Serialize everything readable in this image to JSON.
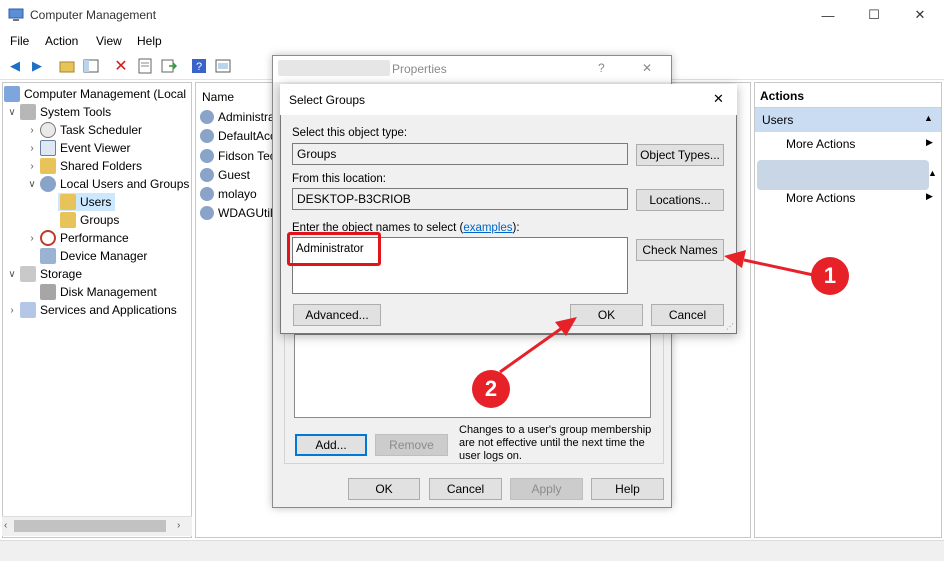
{
  "window": {
    "title": "Computer Management",
    "minimize": "—",
    "maximize": "☐",
    "close": "✕"
  },
  "menu": [
    "File",
    "Action",
    "View",
    "Help"
  ],
  "tree": {
    "root": "Computer Management (Local",
    "system_tools": "System Tools",
    "task_scheduler": "Task Scheduler",
    "event_viewer": "Event Viewer",
    "shared_folders": "Shared Folders",
    "local_users_groups": "Local Users and Groups",
    "users": "Users",
    "groups": "Groups",
    "performance": "Performance",
    "device_manager": "Device Manager",
    "storage": "Storage",
    "disk_management": "Disk Management",
    "services_apps": "Services and Applications"
  },
  "list": {
    "header": "Name",
    "rows": [
      "Administra",
      "DefaultAcc",
      "Fidson Tec",
      "Guest",
      "molayo",
      "WDAGUtil"
    ]
  },
  "actions": {
    "header": "Actions",
    "section1": "Users",
    "more1": "More Actions",
    "more2": "More Actions"
  },
  "properties": {
    "title_suffix": "Properties",
    "help": "?",
    "close": "✕",
    "add": "Add...",
    "remove": "Remove",
    "note": "Changes to a user's group membership are not effective until the next time the user logs on.",
    "ok": "OK",
    "cancel": "Cancel",
    "apply": "Apply",
    "help_btn": "Help"
  },
  "select_groups": {
    "title": "Select Groups",
    "close": "✕",
    "object_type_label": "Select this object type:",
    "object_type_value": "Groups",
    "object_types_btn": "Object Types...",
    "location_label": "From this location:",
    "location_value": "DESKTOP-B3CRIOB",
    "locations_btn": "Locations...",
    "names_label": "Enter the object names to select (",
    "names_link": "examples",
    "names_label_end": "):",
    "names_value": "Administrator",
    "check_names_btn": "Check Names",
    "advanced_btn": "Advanced...",
    "ok_btn": "OK",
    "cancel_btn": "Cancel"
  },
  "annotations": {
    "step1": "1",
    "step2": "2",
    "color": "#e62127"
  }
}
